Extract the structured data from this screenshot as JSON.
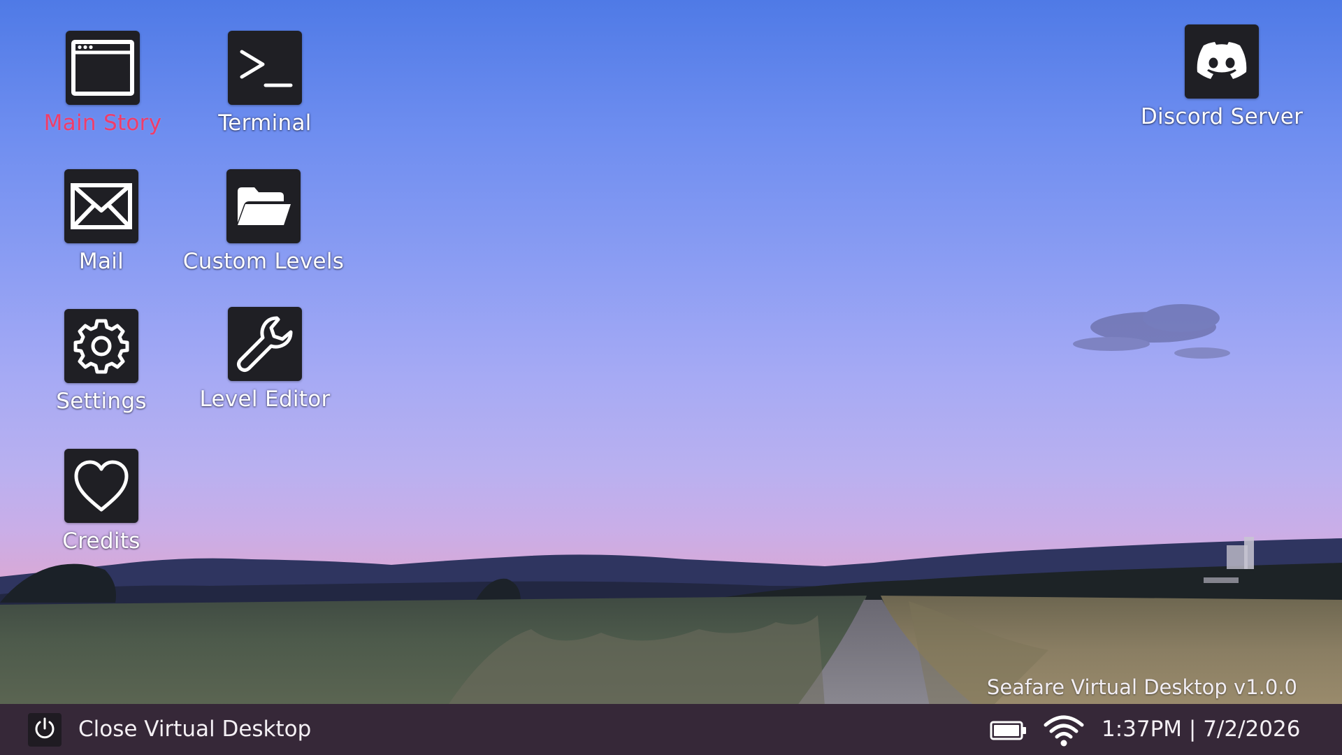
{
  "desktop": {
    "icons": [
      {
        "key": "main-story",
        "label": "Main Story",
        "active": true,
        "icon": "window-icon"
      },
      {
        "key": "terminal",
        "label": "Terminal",
        "active": false,
        "icon": "terminal-icon"
      },
      {
        "key": "mail",
        "label": "Mail",
        "active": false,
        "icon": "mail-icon"
      },
      {
        "key": "custom-levels",
        "label": "Custom Levels",
        "active": false,
        "icon": "folder-icon"
      },
      {
        "key": "settings",
        "label": "Settings",
        "active": false,
        "icon": "gear-icon"
      },
      {
        "key": "level-editor",
        "label": "Level Editor",
        "active": false,
        "icon": "wrench-icon"
      },
      {
        "key": "credits",
        "label": "Credits",
        "active": false,
        "icon": "heart-icon"
      },
      {
        "key": "discord-server",
        "label": "Discord Server",
        "active": false,
        "icon": "discord-icon"
      }
    ],
    "version": "Seafare Virtual Desktop v1.0.0"
  },
  "taskbar": {
    "close_label": "Close Virtual Desktop",
    "power_icon": "power-icon",
    "battery_icon": "battery-icon",
    "wifi_icon": "wifi-icon",
    "clock": "1:37PM | 7/2/2026"
  },
  "colors": {
    "active_label": "#ef3d6a",
    "tile": "#1f1f24",
    "taskbar": "#362838"
  }
}
